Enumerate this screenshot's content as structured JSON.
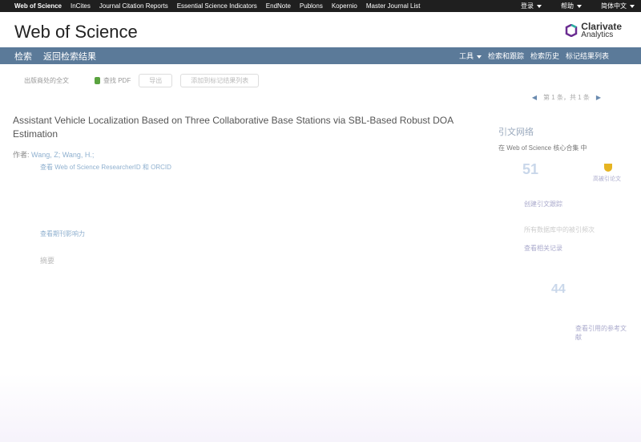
{
  "topnav": {
    "links": [
      "Web of Science",
      "InCites",
      "Journal Citation Reports",
      "Essential Science Indicators",
      "EndNote",
      "Publons",
      "Kopernio",
      "Master Journal List"
    ],
    "login": "登录",
    "help": "帮助",
    "language": "简体中文"
  },
  "brand": {
    "title": "Web of Science",
    "logo_line1": "Clarivate",
    "logo_line2": "Analytics"
  },
  "toolbar": {
    "search": "检索",
    "back": "返回检索结果",
    "tools": "工具",
    "right_items": [
      "检索和跟踪",
      "检索历史",
      "标记结果列表"
    ]
  },
  "actions": {
    "full_text": "出版商处的全文",
    "find_pdf": "查找 PDF",
    "export": "导出",
    "add_to_list": "添加到标记结果列表"
  },
  "pager": {
    "text": "第 1 条，共 1 条"
  },
  "article": {
    "title": "Assistant Vehicle Localization Based on Three Collaborative Base Stations via SBL-Based Robust DOA Estimation",
    "authors_label": "作者:",
    "authors": "Wang, Z; Wang, H.;",
    "meta_link": "查看 Web of Science ResearcherID 和 ORCID",
    "more_link": "查看期刊影响力",
    "abstract_label": "摘要"
  },
  "citation_network": {
    "heading": "引文网络",
    "sub": "在 Web of Science 核心合集 中",
    "times_cited": "51",
    "highly_cited": "高被引论文",
    "create_alert": "创建引文跟踪",
    "all_times_cited": "所有数据库中的被引频次",
    "view_related": "查看相关记录",
    "cited_refs": "44",
    "view_refs": "查看引用的参考文献"
  }
}
